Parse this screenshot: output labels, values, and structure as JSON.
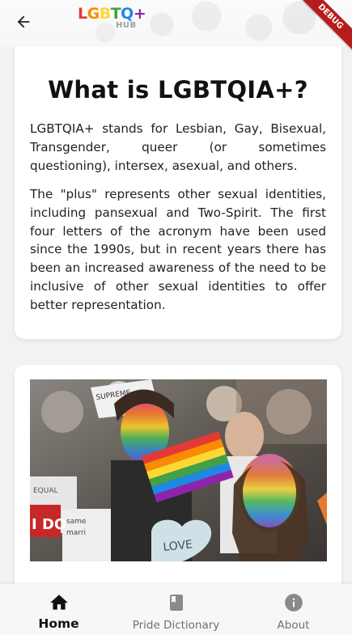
{
  "appbar": {
    "logo_letters": [
      "L",
      "G",
      "B",
      "T",
      "Q",
      "+"
    ],
    "logo_sub": "HUB",
    "debug_label": "DEBUG"
  },
  "intro_card": {
    "title": "What is LGBTQIA+?",
    "paragraph_1": "LGBTQIA+ stands for Lesbian, Gay, Bisexual, Transgender, queer (or sometimes questioning), intersex, asexual, and others.",
    "paragraph_2": "The \"plus\" represents other sexual identities, including pansexual and Two-Spirit. The first four letters of the acronym have been used since the 1990s, but in recent years there has been an increased awareness of the need to be inclusive of other sexual identities to offer better representation."
  },
  "photo_card": {
    "sign_texts": [
      "SUPREME",
      "LOVE",
      "I DO",
      "same",
      "marri",
      "EQUAL"
    ]
  },
  "bottom_nav": {
    "items": [
      {
        "label": "Home",
        "icon": "home-icon",
        "active": true
      },
      {
        "label": "Pride Dictionary",
        "icon": "book-icon",
        "active": false
      },
      {
        "label": "About",
        "icon": "info-icon",
        "active": false
      }
    ]
  },
  "colors": {
    "rainbow": [
      "#e53935",
      "#fb8c00",
      "#fdd835",
      "#43a047",
      "#1e88e5",
      "#8e24aa"
    ],
    "active_nav": "#111111",
    "inactive_nav": "#707070",
    "debug_ribbon": "#b71c1c"
  }
}
